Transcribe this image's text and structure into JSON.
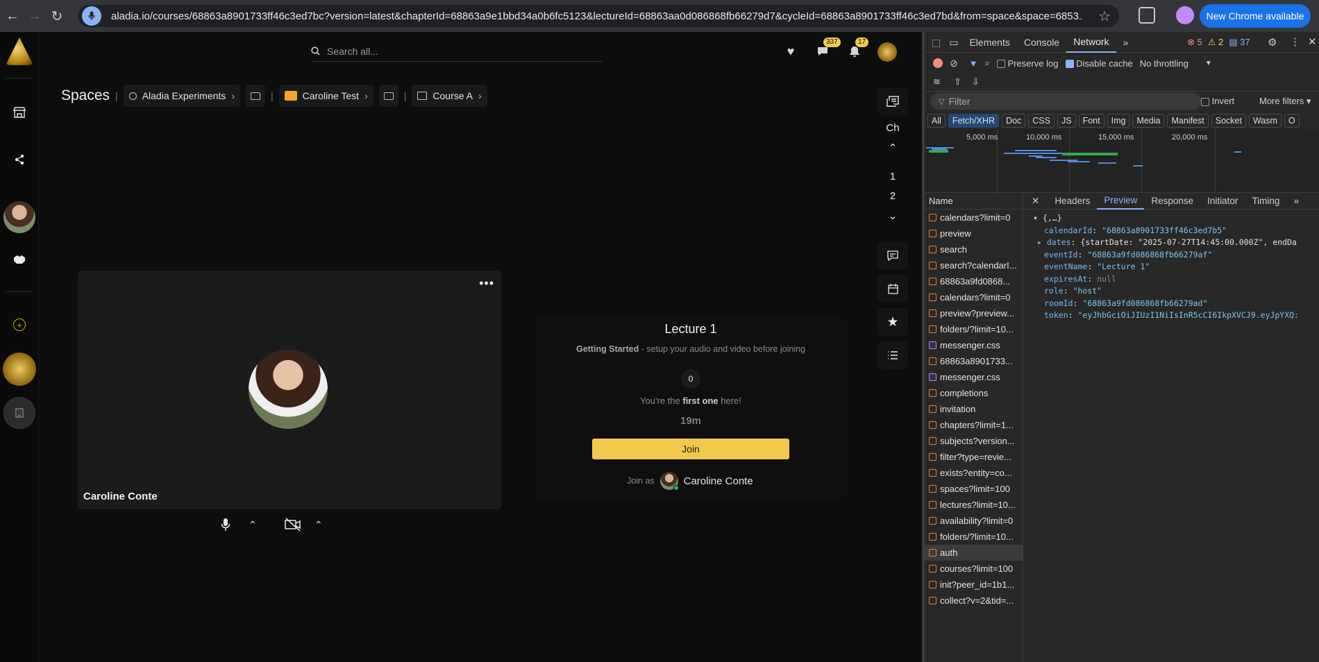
{
  "browser": {
    "url": "aladia.io/courses/68863a8901733ff46c3ed7bc?version=latest&chapterId=68863a9e1bbd34a0b6fc5123&lectureId=68863aa0d086868fb66279d7&cycleId=68863a8901733ff46c3ed7bd&from=space&space=6853...",
    "update_label": "New Chrome available"
  },
  "topbar": {
    "search_placeholder": "Search all...",
    "messages_badge": "337",
    "notifications_badge": "17"
  },
  "breadcrumb": {
    "title": "Spaces",
    "items": [
      {
        "label": "Aladia Experiments"
      },
      {
        "label": "Caroline Test"
      },
      {
        "label": "Course A"
      }
    ]
  },
  "dock": {
    "chapter_label": "Ch",
    "pages": [
      "1",
      "2"
    ]
  },
  "video": {
    "name": "Caroline Conte"
  },
  "join": {
    "title": "Lecture 1",
    "sub_bold": "Getting Started",
    "sub_rest": " - setup your audio and video before joining",
    "count": "0",
    "first_pre": "You're the ",
    "first_bold": "first one",
    "first_post": " here!",
    "time": "19m",
    "button": "Join",
    "join_as_label": "Join as",
    "join_as_name": "Caroline Conte"
  },
  "devtools": {
    "tabs": [
      "Elements",
      "Console",
      "Network"
    ],
    "errors": "5",
    "warnings": "2",
    "messages": "37",
    "preserve_log": "Preserve log",
    "disable_cache": "Disable cache",
    "throttling": "No throttling",
    "filter_placeholder": "Filter",
    "invert": "Invert",
    "more_filters": "More filters",
    "types": [
      "All",
      "Fetch/XHR",
      "Doc",
      "CSS",
      "JS",
      "Font",
      "Img",
      "Media",
      "Manifest",
      "Socket",
      "Wasm",
      "O"
    ],
    "timeline_labels": [
      "5,000 ms",
      "10,000 ms",
      "15,000 ms",
      "20,000 ms"
    ],
    "name_header": "Name",
    "requests": [
      {
        "name": "calendars?limit=0",
        "kind": "xhr"
      },
      {
        "name": "preview",
        "kind": "xhr"
      },
      {
        "name": "search",
        "kind": "xhr"
      },
      {
        "name": "search?calendarI...",
        "kind": "xhr"
      },
      {
        "name": "68863a9fd0868...",
        "kind": "xhr"
      },
      {
        "name": "calendars?limit=0",
        "kind": "xhr"
      },
      {
        "name": "preview?preview...",
        "kind": "xhr"
      },
      {
        "name": "folders/?limit=10...",
        "kind": "xhr"
      },
      {
        "name": "messenger.css",
        "kind": "css"
      },
      {
        "name": "68863a8901733...",
        "kind": "xhr"
      },
      {
        "name": "messenger.css",
        "kind": "css"
      },
      {
        "name": "completions",
        "kind": "xhr"
      },
      {
        "name": "invitation",
        "kind": "xhr"
      },
      {
        "name": "chapters?limit=1...",
        "kind": "xhr"
      },
      {
        "name": "subjects?version...",
        "kind": "xhr"
      },
      {
        "name": "filter?type=revie...",
        "kind": "xhr"
      },
      {
        "name": "exists?entity=co...",
        "kind": "xhr"
      },
      {
        "name": "spaces?limit=100",
        "kind": "xhr"
      },
      {
        "name": "lectures?limit=10...",
        "kind": "xhr"
      },
      {
        "name": "availability?limit=0",
        "kind": "xhr"
      },
      {
        "name": "folders/?limit=10...",
        "kind": "xhr"
      },
      {
        "name": "auth",
        "kind": "xhr",
        "selected": true
      },
      {
        "name": "courses?limit=100",
        "kind": "xhr"
      },
      {
        "name": "init?peer_id=1b1...",
        "kind": "xhr"
      },
      {
        "name": "collect?v=2&tid=...",
        "kind": "xhr"
      }
    ],
    "detail_tabs": [
      "Headers",
      "Preview",
      "Response",
      "Initiator",
      "Timing"
    ],
    "preview": [
      {
        "key": "",
        "value": "{,…}",
        "type": "p"
      },
      {
        "key": "calendarId",
        "value": "\"68863a8901733ff46c3ed7b5\"",
        "type": "s"
      },
      {
        "key": "dates",
        "value": "{startDate: \"2025-07-27T14:45:00.000Z\", endDa",
        "type": "p"
      },
      {
        "key": "eventId",
        "value": "\"68863a9fd086868fb66279af\"",
        "type": "s"
      },
      {
        "key": "eventName",
        "value": "\"Lecture 1\"",
        "type": "s"
      },
      {
        "key": "expiresAt",
        "value": "null",
        "type": "n"
      },
      {
        "key": "role",
        "value": "\"host\"",
        "type": "s"
      },
      {
        "key": "roomId",
        "value": "\"68863a9fd086868fb66279ad\"",
        "type": "s"
      },
      {
        "key": "token",
        "value": "\"eyJhbGciOiJIUzI1NiIsInR5cCI6IkpXVCJ9.eyJpYXQ:",
        "type": "s"
      }
    ]
  }
}
